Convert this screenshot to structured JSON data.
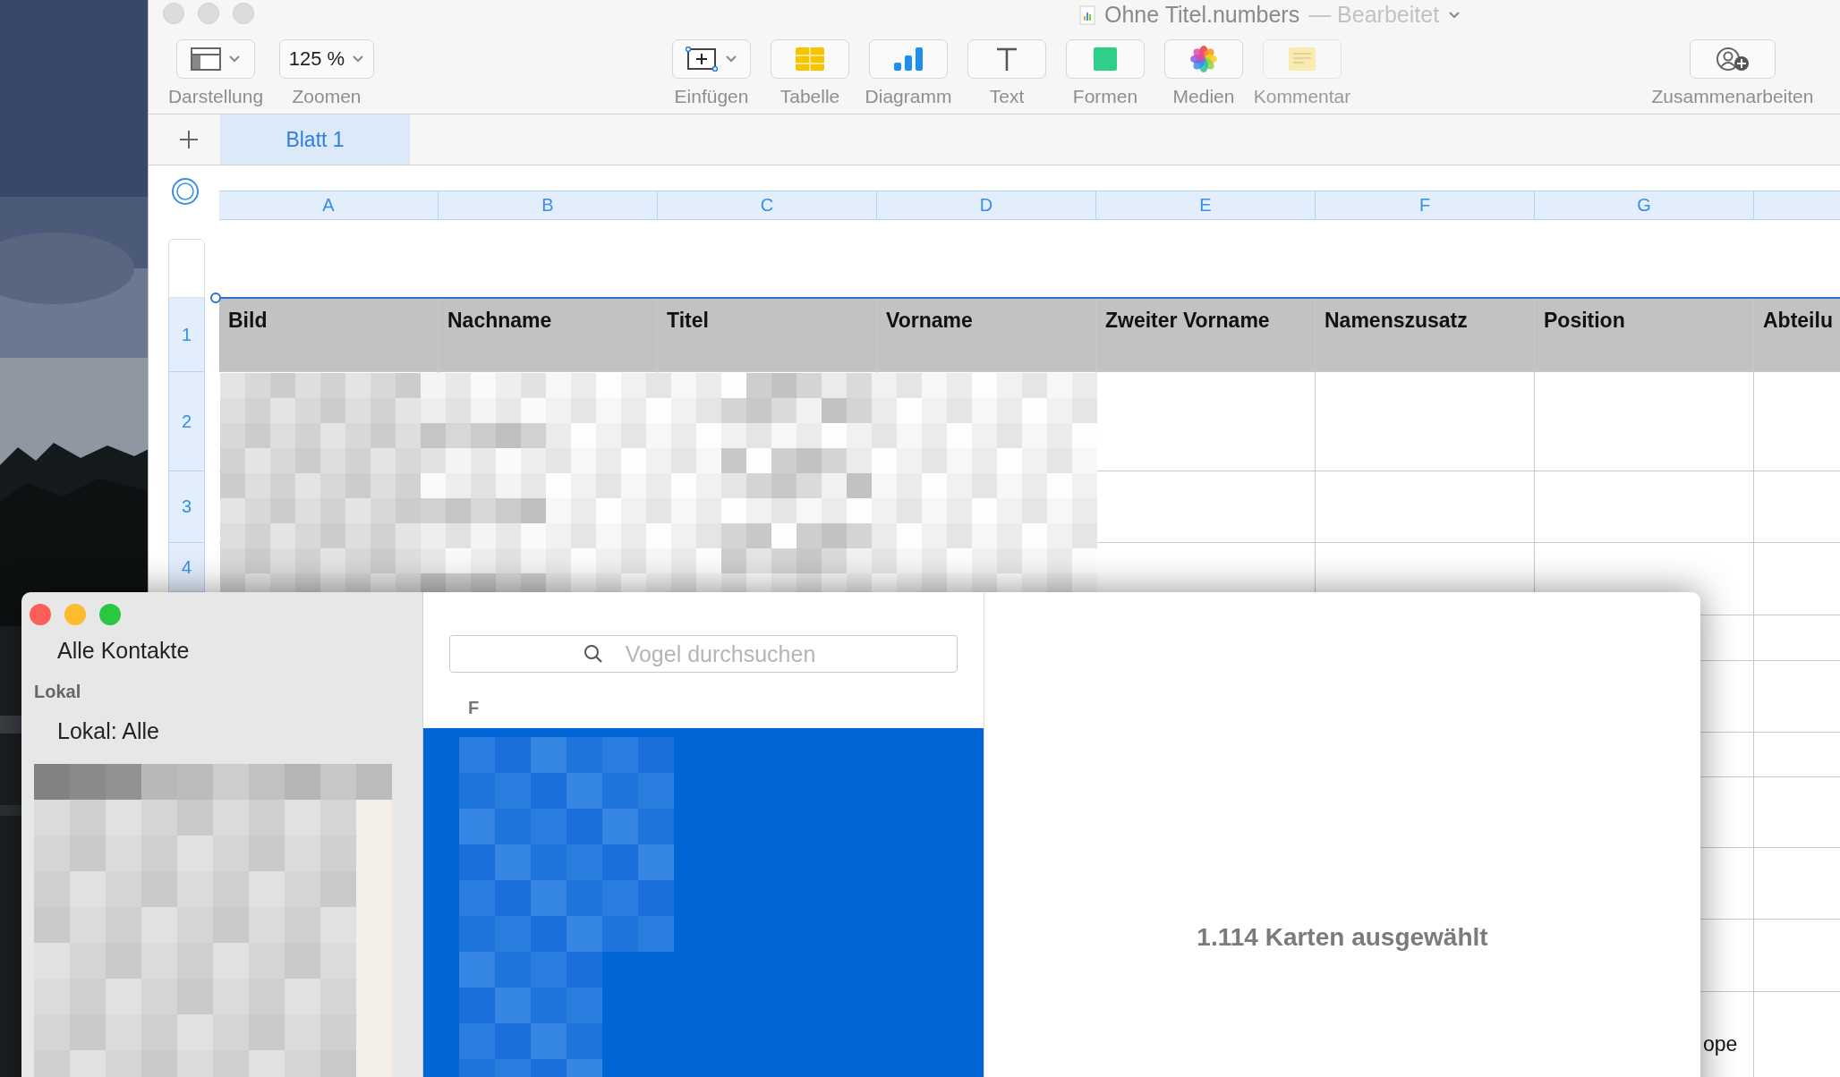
{
  "numbers_window": {
    "title": "Ohne Titel.numbers",
    "status": "— Bearbeitet",
    "toolbar": [
      {
        "kind": "view",
        "label": "Darstellung",
        "disabled": false
      },
      {
        "kind": "zoom",
        "label": "Zoomen",
        "value": "125 %",
        "disabled": false
      },
      {
        "kind": "insert",
        "label": "Einfügen",
        "disabled": false
      },
      {
        "kind": "table",
        "label": "Tabelle",
        "disabled": false
      },
      {
        "kind": "chart",
        "label": "Diagramm",
        "disabled": false
      },
      {
        "kind": "text",
        "label": "Text",
        "disabled": false
      },
      {
        "kind": "shape",
        "label": "Formen",
        "disabled": false
      },
      {
        "kind": "media",
        "label": "Medien",
        "disabled": false
      },
      {
        "kind": "comment",
        "label": "Kommentar",
        "disabled": true
      },
      {
        "kind": "collaborate",
        "label": "Zusammenarbeiten",
        "disabled": false
      }
    ],
    "sheet_tabs": [
      {
        "label": "Blatt 1",
        "selected": true
      }
    ],
    "column_letters": [
      "A",
      "B",
      "C",
      "D",
      "E",
      "F",
      "G"
    ],
    "row_numbers": [
      "1",
      "2",
      "3",
      "4"
    ],
    "table": {
      "columns": [
        "Bild",
        "Nachname",
        "Titel",
        "Vorname",
        "Zweiter Vorname",
        "Namenszusatz",
        "Position",
        "Abteilu"
      ],
      "visible_cell_text": "ope"
    }
  },
  "contacts_window": {
    "sidebar": {
      "items": [
        {
          "kind": "item",
          "label": "Alle Kontakte"
        },
        {
          "kind": "section",
          "label": "Lokal"
        },
        {
          "kind": "item",
          "label": "Lokal: Alle"
        }
      ]
    },
    "search": {
      "placeholder": "Vogel durchsuchen"
    },
    "list": {
      "section": "F"
    },
    "detail": {
      "summary": "1.114 Karten ausgewählt"
    }
  }
}
